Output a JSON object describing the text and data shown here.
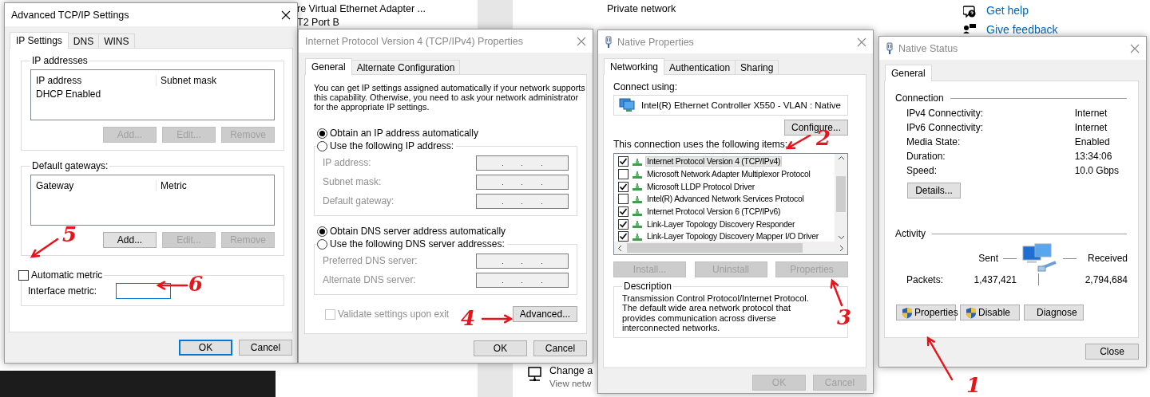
{
  "background": {
    "adapter_items": [
      {
        "label": "re Virtual Ethernet Adapter ..."
      },
      {
        "label": "T2 Port B"
      }
    ],
    "network_profile": "Private network",
    "help_links": [
      {
        "kind": "help",
        "label": "Get help"
      },
      {
        "kind": "feedback",
        "label": "Give feedback"
      }
    ],
    "settings_links": [
      {
        "title": "Change a",
        "subtitle": "View netw"
      }
    ]
  },
  "windows": [
    {
      "kind": "advanced_tcpip",
      "title": "Advanced TCP/IP Settings",
      "active": true,
      "tabs": [
        {
          "label": "IP Settings",
          "selected": true
        },
        {
          "label": "DNS",
          "selected": false
        },
        {
          "label": "WINS",
          "selected": false
        }
      ],
      "groups": [
        {
          "legend": "IP addresses",
          "columns": [
            "IP address",
            "Subnet mask"
          ],
          "rows": [
            [
              "DHCP Enabled"
            ]
          ],
          "buttons": [
            {
              "label": "Add...",
              "disabled": true
            },
            {
              "label": "Edit...",
              "disabled": true
            },
            {
              "label": "Remove",
              "disabled": true
            }
          ]
        },
        {
          "legend": "Default gateways:",
          "columns": [
            "Gateway",
            "Metric"
          ],
          "buttons": [
            {
              "label": "Add...",
              "disabled": false
            },
            {
              "label": "Edit...",
              "disabled": true
            },
            {
              "label": "Remove",
              "disabled": true
            }
          ]
        }
      ],
      "automatic_metric": {
        "label": "Automatic metric",
        "checked": false
      },
      "interface_metric": {
        "label": "Interface metric:",
        "focused": true
      },
      "footer_buttons": [
        {
          "label": "OK",
          "default": true,
          "disabled": false
        },
        {
          "label": "Cancel",
          "default": false,
          "disabled": false
        }
      ]
    },
    {
      "kind": "ipv4_properties",
      "title": "Internet Protocol Version 4 (TCP/IPv4) Properties",
      "active": false,
      "tabs": [
        {
          "label": "General",
          "selected": true
        },
        {
          "label": "Alternate Configuration",
          "selected": false
        }
      ],
      "intro": "You can get IP settings assigned automatically if your network supports this capability. Otherwise, you need to ask your network administrator for the appropriate IP settings.",
      "address_options": [
        {
          "label": "Obtain an IP address automatically",
          "selected": true
        },
        {
          "label": "Use the following IP address:",
          "selected": false,
          "fields": [
            {
              "label": "IP address:",
              "disabled": true
            },
            {
              "label": "Subnet mask:",
              "disabled": true
            },
            {
              "label": "Default gateway:",
              "disabled": true
            }
          ]
        }
      ],
      "dns_options": [
        {
          "label": "Obtain DNS server address automatically",
          "selected": true
        },
        {
          "label": "Use the following DNS server addresses:",
          "selected": false,
          "fields": [
            {
              "label": "Preferred DNS server:",
              "disabled": true
            },
            {
              "label": "Alternate DNS server:",
              "disabled": true
            }
          ]
        }
      ],
      "validate": {
        "label": "Validate settings upon exit",
        "checked": false,
        "disabled": true
      },
      "advanced_button": {
        "label": "Advanced...",
        "disabled": false
      },
      "footer_buttons": [
        {
          "label": "OK",
          "default": false,
          "disabled": false
        },
        {
          "label": "Cancel",
          "default": false,
          "disabled": false
        }
      ]
    },
    {
      "kind": "adapter_properties",
      "title": "Native Properties",
      "active": false,
      "tabs": [
        {
          "label": "Networking",
          "selected": true
        },
        {
          "label": "Authentication",
          "selected": false
        },
        {
          "label": "Sharing",
          "selected": false
        }
      ],
      "connect_label": "Connect using:",
      "adapter": "Intel(R) Ethernet Controller X550 - VLAN : Native",
      "configure_button": {
        "label": "Configure...",
        "disabled": false
      },
      "items_label": "This connection uses the following items:",
      "items": [
        {
          "label": "Internet Protocol Version 4 (TCP/IPv4)",
          "checked": true,
          "selected": true
        },
        {
          "label": "Microsoft Network Adapter Multiplexor Protocol",
          "checked": false,
          "selected": false
        },
        {
          "label": "Microsoft LLDP Protocol Driver",
          "checked": true,
          "selected": false
        },
        {
          "label": "Intel(R) Advanced Network Services Protocol",
          "checked": false,
          "selected": false
        },
        {
          "label": "Internet Protocol Version 6 (TCP/IPv6)",
          "checked": true,
          "selected": false
        },
        {
          "label": "Link-Layer Topology Discovery Responder",
          "checked": true,
          "selected": false
        },
        {
          "label": "Link-Layer Topology Discovery Mapper I/O Driver",
          "checked": true,
          "selected": false
        }
      ],
      "item_buttons": [
        {
          "label": "Install...",
          "disabled": true
        },
        {
          "label": "Uninstall",
          "disabled": true
        },
        {
          "label": "Properties",
          "disabled": true
        }
      ],
      "description": {
        "legend": "Description",
        "text": "Transmission Control Protocol/Internet Protocol. The default wide area network protocol that provides communication across diverse interconnected networks."
      },
      "footer_buttons": [
        {
          "label": "OK",
          "default": false,
          "disabled": true
        },
        {
          "label": "Cancel",
          "default": false,
          "disabled": true
        }
      ]
    },
    {
      "kind": "adapter_status",
      "title": "Native Status",
      "active": false,
      "tabs": [
        {
          "label": "General",
          "selected": true
        }
      ],
      "connection": {
        "heading": "Connection",
        "rows": [
          {
            "label": "IPv4 Connectivity:",
            "value": "Internet"
          },
          {
            "label": "IPv6 Connectivity:",
            "value": "Internet"
          },
          {
            "label": "Media State:",
            "value": "Enabled"
          },
          {
            "label": "Duration:",
            "value": "13:34:06"
          },
          {
            "label": "Speed:",
            "value": "10.0 Gbps"
          }
        ]
      },
      "details_button": {
        "label": "Details...",
        "disabled": false
      },
      "activity": {
        "heading": "Activity",
        "sent_label": "Sent",
        "received_label": "Received",
        "rows": [
          {
            "label": "Packets:",
            "sent": "1,437,421",
            "received": "2,794,684"
          }
        ]
      },
      "action_buttons": [
        {
          "label": "Properties",
          "elevated": true,
          "disabled": false
        },
        {
          "label": "Disable",
          "elevated": true,
          "disabled": false
        },
        {
          "label": "Diagnose",
          "elevated": false,
          "disabled": false
        }
      ],
      "footer_buttons": [
        {
          "label": "Close",
          "default": false,
          "disabled": false
        }
      ]
    }
  ],
  "annotations": [
    {
      "label": "1"
    },
    {
      "label": "2"
    },
    {
      "label": "3"
    },
    {
      "label": "4"
    },
    {
      "label": "5"
    },
    {
      "label": "6"
    }
  ]
}
